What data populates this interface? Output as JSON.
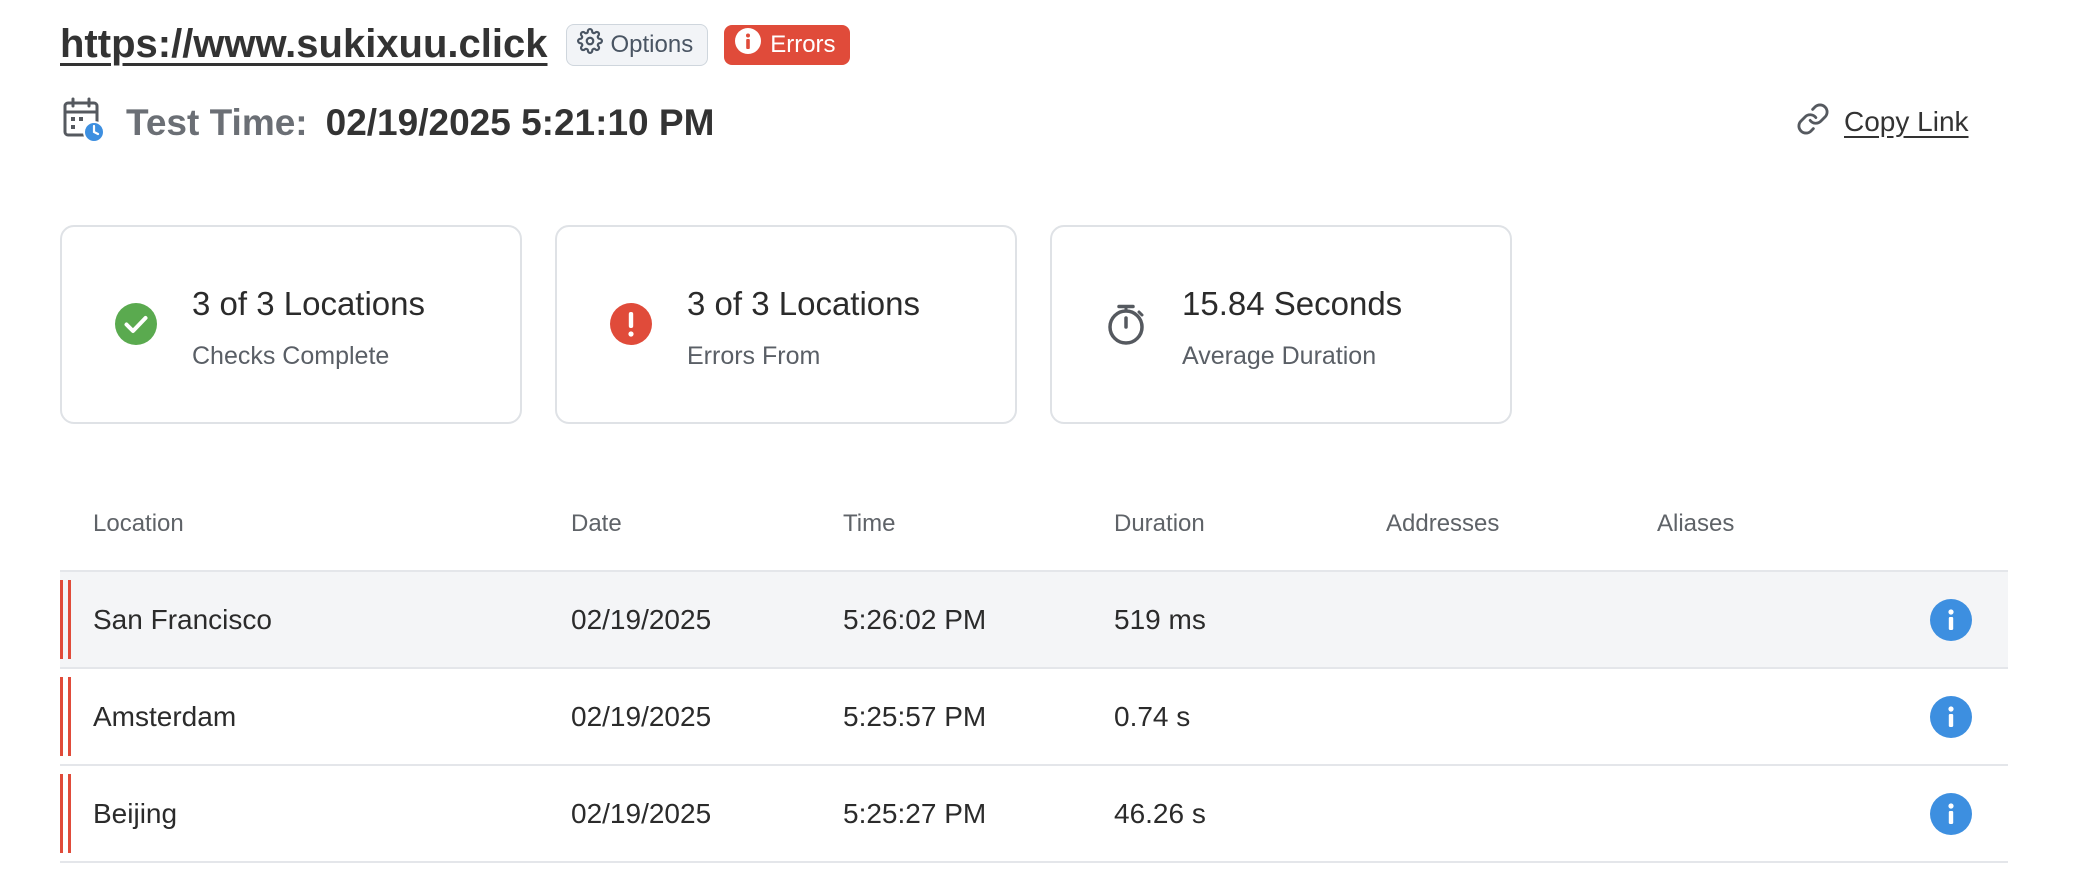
{
  "header": {
    "url": "https://www.sukixuu.click",
    "options_label": "Options",
    "errors_label": "Errors"
  },
  "test_time": {
    "label": "Test Time:",
    "value": "02/19/2025 5:21:10 PM"
  },
  "copy_link_label": "Copy Link",
  "cards": [
    {
      "title": "3 of 3 Locations",
      "subtitle": "Checks Complete",
      "icon": "check-circle-icon",
      "color": "#5aaa4f"
    },
    {
      "title": "3 of 3 Locations",
      "subtitle": "Errors From",
      "icon": "error-circle-icon",
      "color": "#e04b3a"
    },
    {
      "title": "15.84 Seconds",
      "subtitle": "Average Duration",
      "icon": "stopwatch-icon",
      "color": "#55595f"
    }
  ],
  "table": {
    "columns": [
      "Location",
      "Date",
      "Time",
      "Duration",
      "Addresses",
      "Aliases"
    ],
    "rows": [
      {
        "location": "San Francisco",
        "date": "02/19/2025",
        "time": "5:26:02 PM",
        "duration": "519 ms",
        "addresses": "",
        "aliases": ""
      },
      {
        "location": "Amsterdam",
        "date": "02/19/2025",
        "time": "5:25:57 PM",
        "duration": "0.74 s",
        "addresses": "",
        "aliases": ""
      },
      {
        "location": "Beijing",
        "date": "02/19/2025",
        "time": "5:25:27 PM",
        "duration": "46.26 s",
        "addresses": "",
        "aliases": ""
      }
    ]
  },
  "colors": {
    "error": "#e04b3a",
    "success": "#5aaa4f",
    "info": "#3d8fe0"
  }
}
